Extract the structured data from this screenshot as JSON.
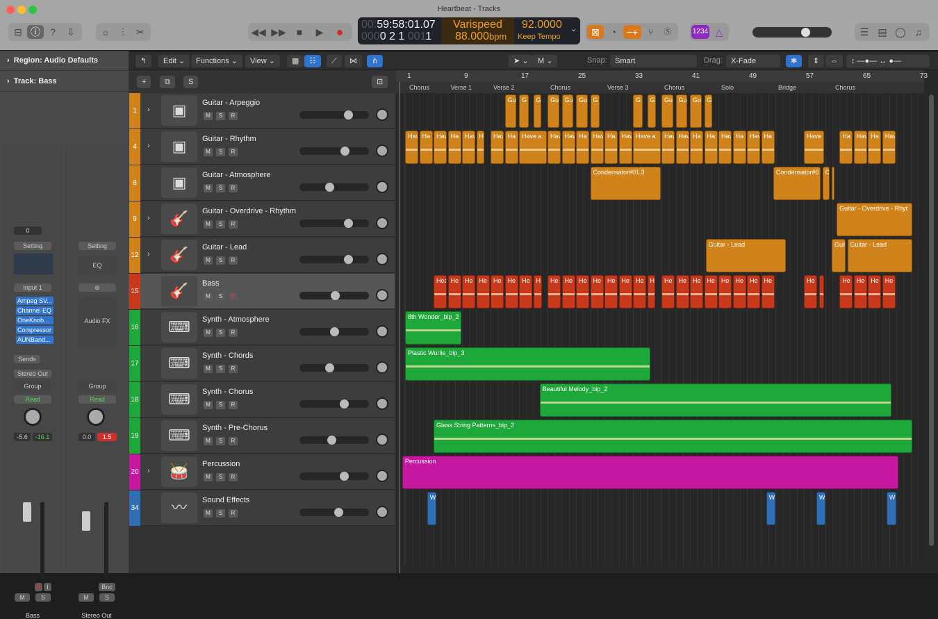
{
  "window": {
    "title": "Heartbeat - Tracks"
  },
  "lcd": {
    "time": "59:58:01.07",
    "time_dim": "00:",
    "bars": "0 2 1",
    "bars_dim": "000",
    "bars_end": "1",
    "bars_end_dim": "001",
    "mode": "Varispeed",
    "tempo": "88.000",
    "tempo_unit": "bpm",
    "rate": "92.0000",
    "rate_mode": "Keep Tempo"
  },
  "toolbar": {
    "count_in": "1234"
  },
  "tb2": {
    "edit": "Edit",
    "functions": "Functions",
    "view": "View",
    "snap_label": "Snap:",
    "snap": "Smart",
    "drag_label": "Drag:",
    "drag": "X-Fade",
    "tool": "M"
  },
  "inspector": {
    "region": "Region: Audio Defaults",
    "track": "Track: Bass",
    "strip1": {
      "gain": "0",
      "setting": "Setting",
      "input": "Input 1",
      "plugins": [
        "Ampeg SV...",
        "Channel EQ",
        "OneKnob...",
        "Compressor",
        "AUNBand..."
      ],
      "sends": "Sends",
      "output": "Stereo Out",
      "group": "Group",
      "auto": "Read",
      "vol": "-5.6",
      "peak": "-16.1",
      "ri": [
        "R",
        "I"
      ],
      "m": "M",
      "s": "S",
      "name": "Bass"
    },
    "strip2": {
      "setting": "Setting",
      "eq": "EQ",
      "fx": "Audio FX",
      "group": "Group",
      "auto": "Read",
      "vol": "0.0",
      "peak": "1.5",
      "bnc": "Bnc",
      "m": "M",
      "s": "S",
      "name": "Stereo Out"
    },
    "scale": [
      "0",
      "3",
      "6",
      "9",
      "12",
      "15",
      "18",
      "21",
      "24",
      "30",
      "35",
      "40",
      "45",
      "50",
      "60"
    ]
  },
  "header": {
    "add": "+",
    "s": "S"
  },
  "ruler": {
    "bars": [
      "1",
      "9",
      "17",
      "25",
      "33",
      "41",
      "49",
      "57",
      "65",
      "73"
    ],
    "markers": [
      [
        "Chorus",
        1
      ],
      [
        "Verse 1",
        7
      ],
      [
        "Verse 2",
        13
      ],
      [
        "Chorus",
        21
      ],
      [
        "Verse 3",
        29
      ],
      [
        "Chorus",
        37
      ],
      [
        "Solo",
        45
      ],
      [
        "Bridge",
        53
      ],
      [
        "Chorus",
        61
      ]
    ]
  },
  "colors": {
    "orange": "#d0831a",
    "red": "#c8391c",
    "green": "#1fa83a",
    "magenta": "#c5179f",
    "blue": "#2f6db5"
  },
  "tracks": [
    {
      "num": "1",
      "name": "Guitar - Arpeggio",
      "icon": "amp-icon",
      "color": "orange",
      "volume": 0.73,
      "expand": true,
      "regions": [
        [
          "Gui",
          15,
          16.8
        ],
        [
          "G",
          17,
          18.5
        ],
        [
          "G",
          19,
          20.3
        ],
        [
          "Gui",
          21,
          22.8
        ],
        [
          "Gui",
          23,
          24.8
        ],
        [
          "Gui",
          25,
          26.8
        ],
        [
          "G",
          27,
          28.5
        ],
        [
          "G",
          33,
          34.5
        ],
        [
          "G",
          35,
          36.4
        ],
        [
          "Gui",
          37,
          38.8
        ],
        [
          "Gui",
          39,
          40.8
        ],
        [
          "Gui",
          41,
          42.8
        ],
        [
          "G",
          43,
          44.3
        ]
      ]
    },
    {
      "num": "4",
      "name": "Guitar - Rhythm",
      "icon": "amp-icon",
      "color": "orange",
      "volume": 0.68,
      "expand": true,
      "wave": true,
      "regions": [
        [
          "Hav",
          1,
          3
        ],
        [
          "Ha",
          3,
          5
        ],
        [
          "Hav",
          5,
          7
        ],
        [
          "Ha",
          7,
          9
        ],
        [
          "Hav",
          9,
          11
        ],
        [
          "H",
          11,
          12.3
        ],
        [
          "Hav",
          13,
          15
        ],
        [
          "Ha",
          15,
          17
        ],
        [
          "Have a",
          17,
          21
        ],
        [
          "Hav",
          21,
          23
        ],
        [
          "Hav",
          23,
          25
        ],
        [
          "Ha",
          25,
          27
        ],
        [
          "Hav",
          27,
          29
        ],
        [
          "Ha",
          29,
          31
        ],
        [
          "Hav",
          31,
          33
        ],
        [
          "Have a",
          33,
          37
        ],
        [
          "Hav",
          37,
          39
        ],
        [
          "Hav",
          39,
          41
        ],
        [
          "Ha",
          41,
          43
        ],
        [
          "Ha",
          43,
          45
        ],
        [
          "Hav",
          45,
          47
        ],
        [
          "Ha",
          47,
          49
        ],
        [
          "Hav",
          49,
          51
        ],
        [
          "Ha",
          51,
          53
        ],
        [
          "Have",
          57,
          60
        ],
        [
          "Ha",
          62,
          64
        ],
        [
          "Hav",
          64,
          66
        ],
        [
          "Ha",
          66,
          68
        ],
        [
          "Hav",
          68,
          70
        ]
      ]
    },
    {
      "num": "8",
      "name": "Guitar - Atmosphere",
      "icon": "amp-icon",
      "color": "orange",
      "volume": 0.42,
      "expand": false,
      "regions": [
        [
          "Condensator#01.3",
          27,
          37
        ],
        [
          "Condensator#0",
          52.7,
          59.5
        ],
        [
          "C",
          59.6,
          60.8
        ],
        [
          "",
          60.9,
          61.3
        ]
      ]
    },
    {
      "num": "9",
      "name": "Guitar - Overdrive - Rhythm",
      "icon": "electric-guitar-icon",
      "color": "orange",
      "volume": 0.73,
      "expand": true,
      "regions": [
        [
          "Guitar - Overdrive - Rhyt",
          61.6,
          72.4
        ]
      ]
    },
    {
      "num": "12",
      "name": "Guitar - Lead",
      "icon": "electric-guitar-icon",
      "color": "orange",
      "volume": 0.73,
      "expand": true,
      "regions": [
        [
          "Guitar - Lead",
          43.2,
          54.6
        ],
        [
          "Guit",
          60.9,
          63
        ],
        [
          "Guitar - Lead",
          63.1,
          72.4
        ]
      ]
    },
    {
      "num": "15",
      "name": "Bass",
      "icon": "bass-guitar-icon",
      "color": "red",
      "volume": 0.52,
      "expand": false,
      "selected": true,
      "wave": true,
      "regions": [
        [
          "Hea",
          5,
          7
        ],
        [
          "He",
          7,
          9
        ],
        [
          "He",
          9,
          11
        ],
        [
          "He",
          11,
          13
        ],
        [
          "He",
          13,
          15
        ],
        [
          "He",
          15,
          17
        ],
        [
          "He",
          17,
          19
        ],
        [
          "H",
          19,
          20.4
        ],
        [
          "He",
          21,
          23
        ],
        [
          "He",
          23,
          25
        ],
        [
          "He",
          25,
          27
        ],
        [
          "He",
          27,
          29
        ],
        [
          "He",
          29,
          31
        ],
        [
          "He",
          31,
          33
        ],
        [
          "He",
          33,
          35
        ],
        [
          "H",
          35,
          36.3
        ],
        [
          "He",
          37,
          39
        ],
        [
          "He",
          39,
          41
        ],
        [
          "He",
          41,
          43
        ],
        [
          "He",
          43,
          45
        ],
        [
          "He",
          45,
          47
        ],
        [
          "He",
          47,
          49
        ],
        [
          "He",
          49,
          51
        ],
        [
          "He",
          51,
          53
        ],
        [
          "He",
          57,
          59
        ],
        [
          "",
          59.1,
          60
        ],
        [
          "He",
          62,
          64
        ],
        [
          "He",
          64,
          66
        ],
        [
          "He",
          66,
          68
        ],
        [
          "He",
          68,
          70
        ]
      ]
    },
    {
      "num": "16",
      "name": "Synth - Atmosphere",
      "icon": "keyboard-icon",
      "color": "green",
      "volume": 0.51,
      "expand": false,
      "wave": true,
      "regions": [
        [
          "8th Wonder_bip_2",
          1,
          9
        ]
      ]
    },
    {
      "num": "17",
      "name": "Synth - Chords",
      "icon": "keyboard-icon",
      "color": "green",
      "volume": 0.42,
      "expand": false,
      "wave": true,
      "regions": [
        [
          "Plastic Wurlie_bip_3",
          1,
          35.6
        ]
      ]
    },
    {
      "num": "18",
      "name": "Synth - Chorus",
      "icon": "keyboard-icon",
      "color": "green",
      "volume": 0.67,
      "expand": false,
      "wave": true,
      "regions": [
        [
          "Beautiful Melody_bip_2",
          19.9,
          69.4
        ]
      ]
    },
    {
      "num": "19",
      "name": "Synth - Pre-Chorus",
      "icon": "keyboard-icon",
      "color": "green",
      "volume": 0.46,
      "expand": false,
      "wave": true,
      "regions": [
        [
          "Glass String Patterns_bip_2",
          5,
          72.4
        ]
      ]
    },
    {
      "num": "20",
      "name": "Percussion",
      "icon": "drum-kit-icon",
      "color": "magenta",
      "volume": 0.67,
      "expand": true,
      "regions": [
        [
          "Percussion",
          0.6,
          70.4
        ]
      ]
    },
    {
      "num": "34",
      "name": "Sound Effects",
      "icon": "waveform-icon",
      "color": "blue",
      "volume": 0.58,
      "expand": false,
      "regions": [
        [
          "W",
          4.1,
          5.5
        ],
        [
          "W",
          51.7,
          53.1
        ],
        [
          "W",
          58.75,
          60.2
        ],
        [
          "W",
          68.6,
          70.1
        ]
      ]
    }
  ],
  "msr": [
    "M",
    "S",
    "R"
  ]
}
